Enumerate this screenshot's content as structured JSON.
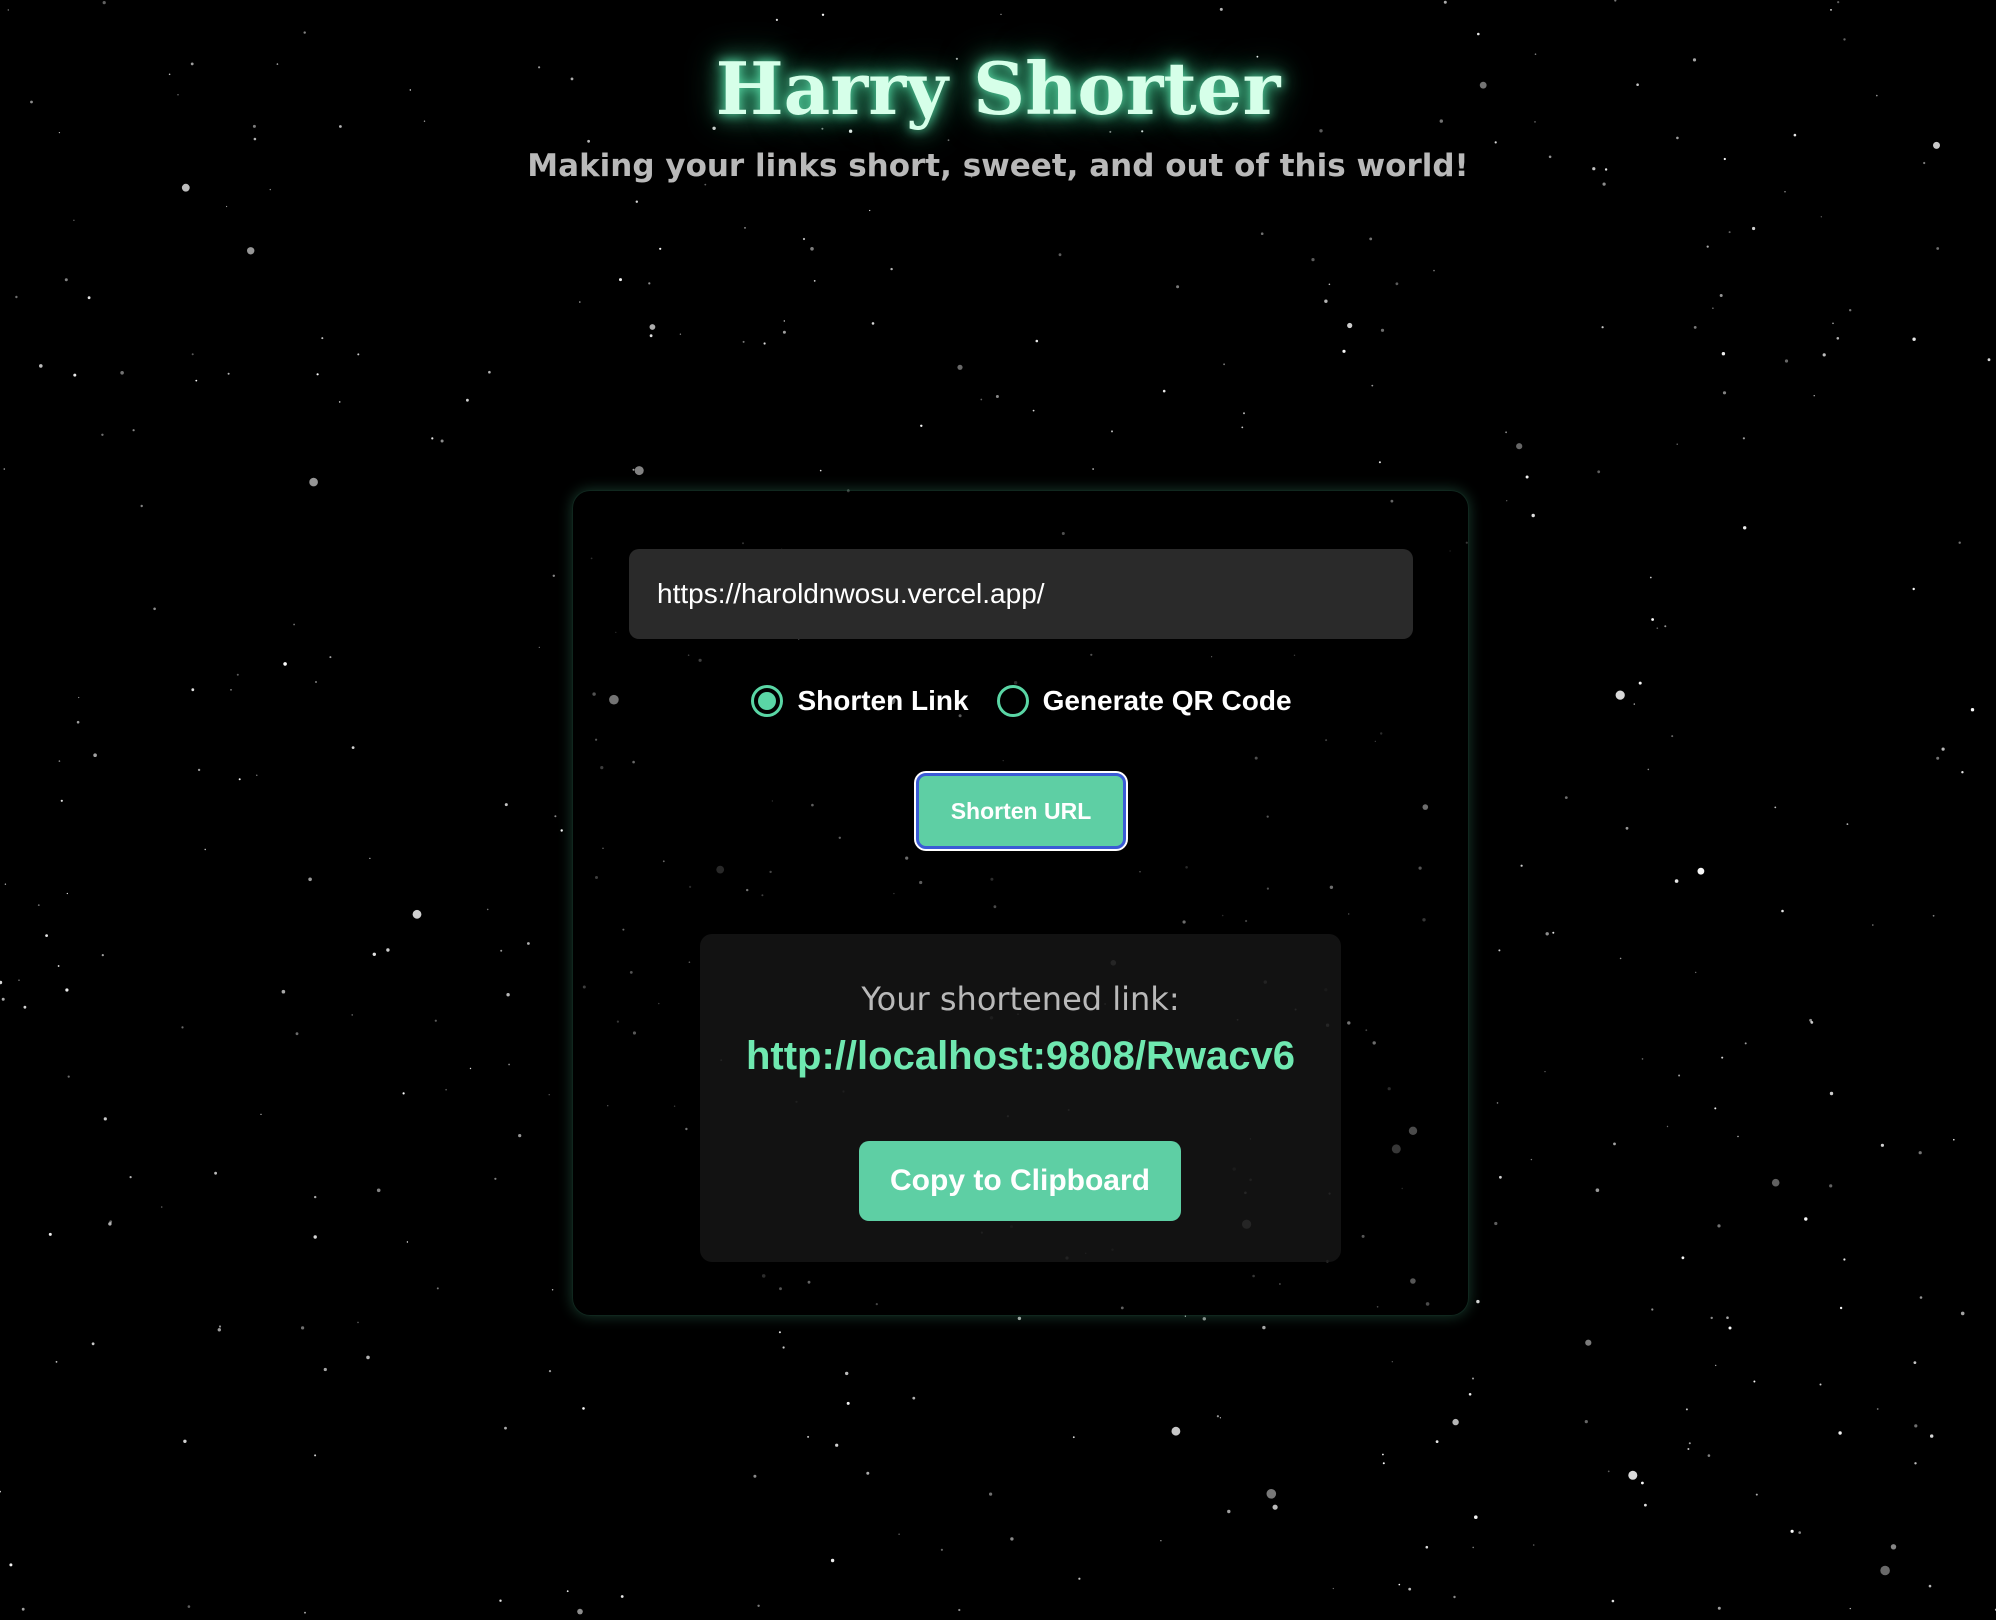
{
  "header": {
    "title": "Harry Shorter",
    "subtitle": "Making your links short, sweet, and out of this world!"
  },
  "form": {
    "url_value": "https://haroldnwosu.vercel.app/",
    "mode_options": [
      {
        "label": "Shorten Link",
        "selected": true
      },
      {
        "label": "Generate QR Code",
        "selected": false
      }
    ],
    "submit_label": "Shorten URL"
  },
  "result": {
    "label": "Your shortened link:",
    "short_url": "http://localhost:9808/Rwacv6",
    "copy_label": "Copy to Clipboard"
  },
  "colors": {
    "background": "#000000",
    "accent": "#5ecfa4",
    "link": "#6fe8b0",
    "title_glow": "#5ad6a5",
    "muted_text": "#b9b9b9",
    "input_bg": "#2a2a2a"
  }
}
